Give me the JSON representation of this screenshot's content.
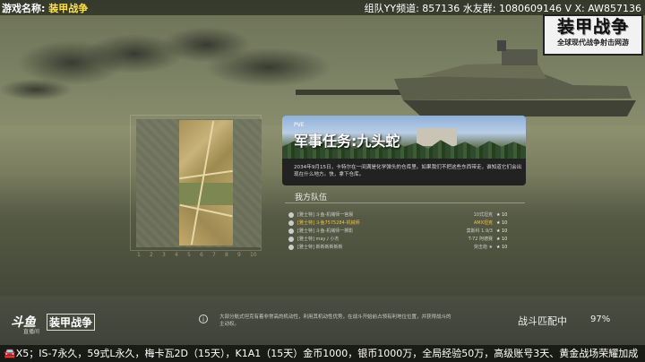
{
  "stream": {
    "game_label": "游戏名称:",
    "game_name": "装甲战争",
    "info": "组队YY频道: 857136   水友群: 1080609146   V X: AW857136"
  },
  "logo_top": {
    "main": "装甲战争",
    "sub": "全球现代战争射击网游"
  },
  "map": {
    "axis": [
      "1",
      "2",
      "3",
      "4",
      "5",
      "6",
      "7",
      "8",
      "9",
      "10"
    ]
  },
  "mission": {
    "tag": "PVE",
    "title": "军事任务:九头蛇",
    "description": "2034年9月15日，卡特尔在一间满是化学弹头的仓库里。如果我们不把这些东西带走，谁知道它们会出现在什么地方。快，拿下仓库。"
  },
  "team": {
    "title": "我方队伍",
    "rows": [
      {
        "name": "[雅士特] 斗鱼-机械师一宫晨",
        "vehicle": "10式坦克",
        "tier": "★",
        "level": "10"
      },
      {
        "name": "[雅士特] 斗鱼7575284-机械师",
        "vehicle": "AMX坦克",
        "tier": "★",
        "level": "10"
      },
      {
        "name": "[雅士特] 斗鱼-机械师一狮影",
        "vehicle": "莫斯科 1.9/3",
        "tier": "★",
        "level": "10"
      },
      {
        "name": "[雅士特] may丿小杰",
        "vehicle": "T-72 阿德赛",
        "tier": "★",
        "level": "10"
      },
      {
        "name": "[雅士特] 新新新新新新",
        "vehicle": "突击炮 ★",
        "tier": "★",
        "level": "10"
      }
    ]
  },
  "bottom": {
    "logo_sg": "斗鱼",
    "logo_game": "装甲战争",
    "logo_sub": "直播间",
    "info_icon": "i",
    "tip": "大部分航式坦克有着非常高的机动性，利用其机动性优势，在战斗开始前占领有利地位位置，并获得战斗的主动权。",
    "match_label": "战斗匹配中",
    "match_percent": "97%"
  },
  "ticker": "🚘X5；IS-7永久，59式L永久，梅卡瓦2D（15天），K1A1（15天）金币1000，银币1000万，全局经验50万，高级账号3天、黄金战场荣耀加成",
  "colors": {
    "highlight": "#f0c040",
    "title_yellow": "#ffe14a"
  },
  "icons": {
    "info": "info-icon",
    "tank": "tank-icon"
  }
}
